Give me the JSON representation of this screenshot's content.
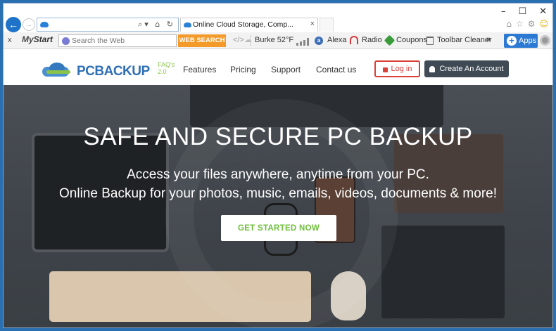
{
  "browser": {
    "tab_title": "Online Cloud Storage, Comp...",
    "tab_close": "×",
    "win_min": "–",
    "win_max": "☐",
    "win_close": "✕",
    "back_glyph": "←",
    "fwd_glyph": "→",
    "addr_icons": "⌕▾ ⌂ ↻"
  },
  "toolbar": {
    "close": "x",
    "brand_my": "My",
    "brand_start": "Start",
    "search_placeholder": "Search the Web",
    "web_search": "WEB SEARCH",
    "weather": "Burke 52°F",
    "alexa": "Alexa",
    "radio": "Radio",
    "coupons": "Coupons",
    "toolbar_cleaner": "Toolbar Cleaner",
    "more": "»",
    "apps": "Apps",
    "apps_plus": "+"
  },
  "site": {
    "logo_text": "PCBACKUP",
    "logo_sup": "FAQ's 2.0",
    "nav": [
      "Features",
      "Pricing",
      "Support",
      "Contact us"
    ],
    "login": "Log in",
    "create_account": "Create An Account"
  },
  "hero": {
    "title": "SAFE AND SECURE PC BACKUP",
    "line1": "Access your files anywhere, anytime from your PC.",
    "line2": "Online Backup for your photos, music, emails, videos, documents & more!",
    "cta": "GET STARTED NOW"
  },
  "colors": {
    "accent_blue": "#2c79d4",
    "web_search_orange": "#f39a28",
    "login_red": "#d9403a",
    "cta_green": "#6fbf3c",
    "account_dark": "#3f4a55"
  }
}
